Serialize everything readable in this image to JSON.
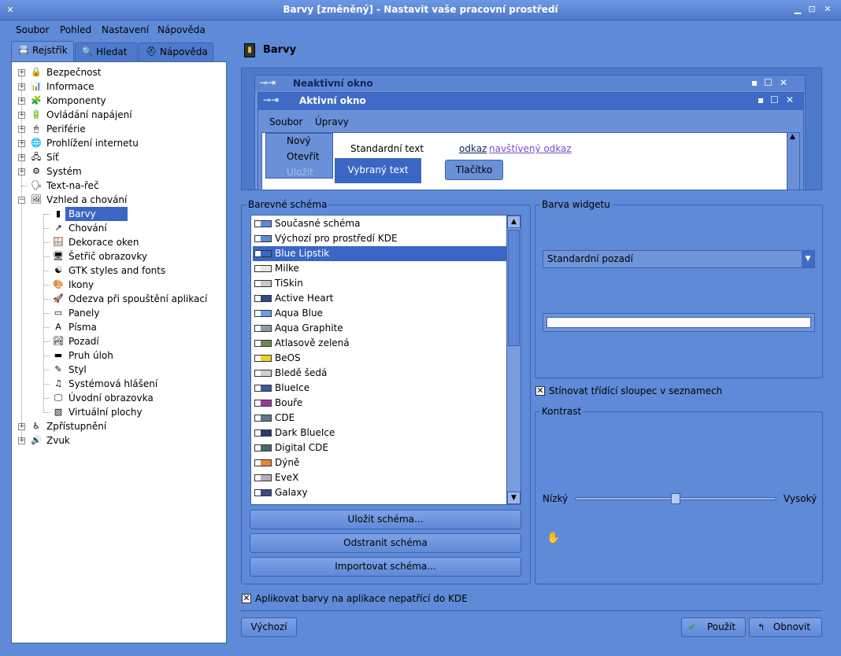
{
  "window": {
    "title": "Barvy [změněný] - Nastavit vaše pracovní prostředí",
    "controls": [
      "minimize-icon",
      "maximize-icon",
      "close-icon"
    ]
  },
  "menubar": [
    "Soubor",
    "Pohled",
    "Nastavení",
    "Nápověda"
  ],
  "tabs": [
    {
      "label": "Rejstřík",
      "icon": "index-icon",
      "active": true
    },
    {
      "label": "Hledat",
      "icon": "search-icon",
      "active": false
    },
    {
      "label": "Nápověda",
      "icon": "help-icon",
      "active": false
    }
  ],
  "tree": [
    {
      "label": "Bezpečnost",
      "expandable": true
    },
    {
      "label": "Informace",
      "expandable": true
    },
    {
      "label": "Komponenty",
      "expandable": true
    },
    {
      "label": "Ovládání napájení",
      "expandable": true
    },
    {
      "label": "Periférie",
      "expandable": true
    },
    {
      "label": "Prohlížení internetu",
      "expandable": true
    },
    {
      "label": "Síť",
      "expandable": true
    },
    {
      "label": "Systém",
      "expandable": true
    },
    {
      "label": "Text-na-řeč",
      "expandable": false
    },
    {
      "label": "Vzhled a chování",
      "expandable": true,
      "expanded": true
    },
    {
      "label": "Barvy",
      "child": true,
      "selected": true
    },
    {
      "label": "Chování",
      "child": true
    },
    {
      "label": "Dekorace oken",
      "child": true
    },
    {
      "label": "Šetřič obrazovky",
      "child": true
    },
    {
      "label": "GTK styles and fonts",
      "child": true
    },
    {
      "label": "Ikony",
      "child": true
    },
    {
      "label": "Odezva při spouštění aplikací",
      "child": true
    },
    {
      "label": "Panely",
      "child": true
    },
    {
      "label": "Písma",
      "child": true
    },
    {
      "label": "Pozadí",
      "child": true
    },
    {
      "label": "Pruh úloh",
      "child": true
    },
    {
      "label": "Styl",
      "child": true
    },
    {
      "label": "Systémová hlášení",
      "child": true
    },
    {
      "label": "Úvodní obrazovka",
      "child": true
    },
    {
      "label": "Virtuální plochy",
      "child": true
    },
    {
      "label": "Zpřístupnění",
      "expandable": true
    },
    {
      "label": "Zvuk",
      "expandable": true
    }
  ],
  "page": {
    "title": "Barvy"
  },
  "preview": {
    "inactive_title": "Neaktivní okno",
    "active_title": "Aktivní okno",
    "menu": [
      "Soubor",
      "Úpravy"
    ],
    "popup_items": [
      "Nový",
      "Otevřít",
      "Uložit"
    ],
    "normal_text": "Standardní text",
    "selected_text": "Vybraný text",
    "link": "odkaz",
    "visited_link": "navštívený odkaz",
    "button": "Tlačítko"
  },
  "schemes": {
    "group_title": "Barevné schéma",
    "items": [
      "Současné schéma",
      "Výchozí pro prostředí KDE",
      "Blue Lipstik",
      "Milke",
      "TiSkin",
      "Active Heart",
      "Aqua Blue",
      "Aqua Graphite",
      "Atlasově zelená",
      "BeOS",
      "Bledě šedá",
      "BlueIce",
      "Bouře",
      "CDE",
      "Dark BlueIce",
      "Digital CDE",
      "Dýně",
      "EveX",
      "Galaxy"
    ],
    "selected": "Blue Lipstik",
    "swatch_colors": [
      "#5e8ad8",
      "#5e8ad8",
      "#3a66c4",
      "#e8e8e8",
      "#c8c8c8",
      "#2c4a8a",
      "#6aa0e0",
      "#8a9aaa",
      "#6a8a5a",
      "#f0d020",
      "#d0d0d0",
      "#3a5a9a",
      "#9a3aa0",
      "#5a7a8a",
      "#2a3a6a",
      "#4a6a6a",
      "#e08a30",
      "#b0b0c0",
      "#3a4a8a"
    ],
    "save_button": "Uložit schéma...",
    "remove_button": "Odstranit schéma",
    "import_button": "Importovat schéma..."
  },
  "widget_color": {
    "group_title": "Barva widgetu",
    "selected_option": "Standardní pozadí",
    "color_value": "#ffffff"
  },
  "shade_column": {
    "label": "Stínovat třídící sloupec v seznamech",
    "checked": true
  },
  "contrast": {
    "group_title": "Kontrast",
    "low": "Nízký",
    "high": "Vysoký",
    "level": 0.5
  },
  "apply_non_kde": {
    "label": "Aplikovat barvy na aplikace nepatřící do KDE",
    "checked": true
  },
  "bottom": {
    "defaults": "Výchozí",
    "apply": "Použít",
    "reset": "Obnovit"
  }
}
